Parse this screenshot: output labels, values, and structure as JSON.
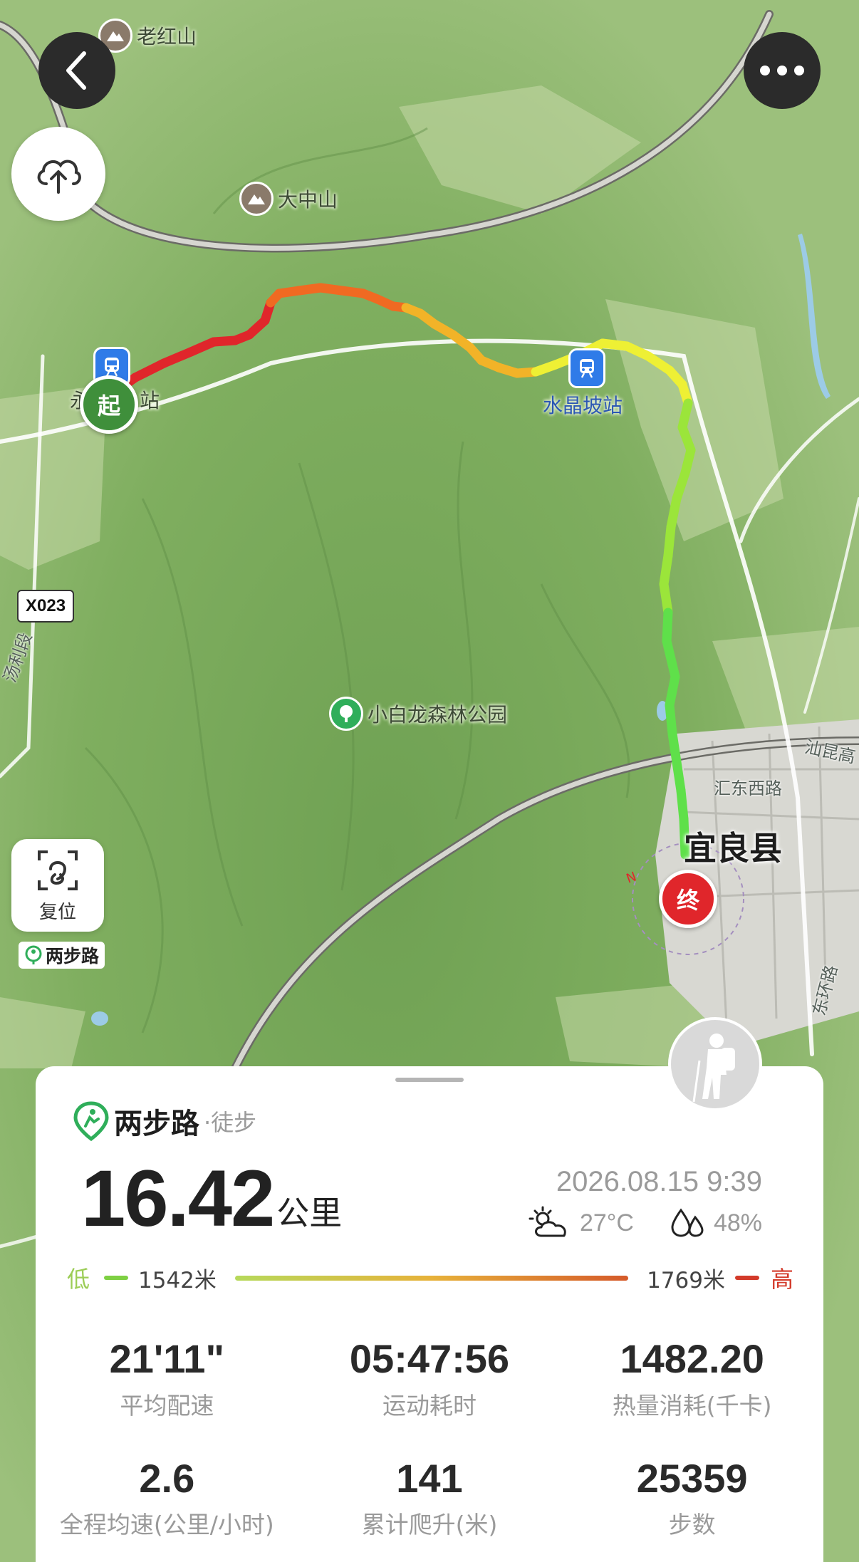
{
  "map": {
    "route_colors": [
      "#e0262b",
      "#f06a22",
      "#f2b328",
      "#eef034",
      "#9be53a",
      "#5fe04a"
    ],
    "pois": [
      {
        "name": "老红山",
        "kind": "mountain"
      },
      {
        "name": "大中山",
        "kind": "mountain"
      },
      {
        "name": "小白龙森林公园",
        "kind": "park"
      }
    ],
    "stations": {
      "start_station_partial": "站",
      "start_station_prefix": "永",
      "crystal": "水晶坡站"
    },
    "road_badge": "X023",
    "roads": {
      "tang_li": "汤利段",
      "huidong": "汇东西路",
      "shankun": "汕昆高",
      "donghuan": "东环路"
    },
    "city": "宜良县",
    "compass_n": "N",
    "markers": {
      "start": "起",
      "end": "终"
    }
  },
  "controls": {
    "back_icon": "chevron-left-icon",
    "more_icon": "more-dots-icon",
    "upload_icon": "cloud-upload-icon",
    "reset_label": "复位",
    "brand_tag": "两步路"
  },
  "card": {
    "brand_name": "两步路",
    "brand_sub": "·徒步",
    "distance_value": "16.42",
    "distance_unit": "公里",
    "datetime": "2026.08.15 9:39",
    "temperature": "27°C",
    "humidity": "48%",
    "elevation": {
      "low_label": "低",
      "low_value": "1542米",
      "high_value": "1769米",
      "high_label": "高"
    },
    "stats": [
      {
        "value": "21'11\"",
        "label": "平均配速"
      },
      {
        "value": "05:47:56",
        "label": "运动耗时"
      },
      {
        "value": "1482.20",
        "label": "热量消耗(千卡)"
      },
      {
        "value": "2.6",
        "label": "全程均速(公里/小时)"
      },
      {
        "value": "141",
        "label": "累计爬升(米)"
      },
      {
        "value": "25359",
        "label": "步数"
      }
    ]
  }
}
